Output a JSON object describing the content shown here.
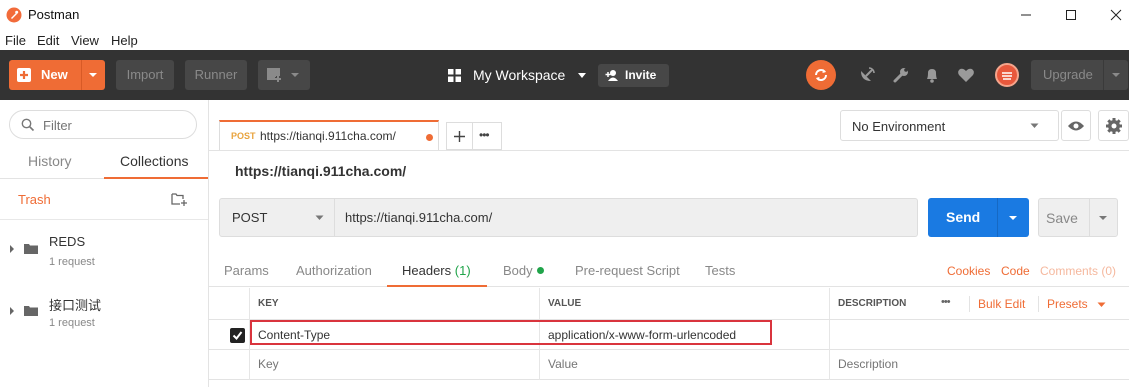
{
  "window": {
    "title": "Postman",
    "logo_color": "#f26b3a"
  },
  "menu": [
    "File",
    "Edit",
    "View",
    "Help"
  ],
  "toolbar": {
    "new_label": "New",
    "import_label": "Import",
    "runner_label": "Runner",
    "workspace_label": "My Workspace",
    "invite_label": "Invite",
    "upgrade_label": "Upgrade",
    "accent": "#ef6c35"
  },
  "sidebar": {
    "filter_placeholder": "Filter",
    "tabs": [
      "History",
      "Collections"
    ],
    "active_tab": "Collections",
    "trash_label": "Trash",
    "collections": [
      {
        "name": "REDS",
        "count": "1 request"
      },
      {
        "name": "接口测试",
        "count": "1 request"
      }
    ]
  },
  "request_tab": {
    "method": "POST",
    "url": "https://tianqi.911cha.com/"
  },
  "environment": {
    "selected": "No Environment"
  },
  "request": {
    "name": "https://tianqi.911cha.com/",
    "method": "POST",
    "url": "https://tianqi.911cha.com/",
    "send_label": "Send",
    "save_label": "Save",
    "send_color": "#1a7ae2"
  },
  "subtabs": {
    "params": "Params",
    "authorization": "Authorization",
    "headers": "Headers",
    "headers_count": "(1)",
    "body": "Body",
    "prerequest": "Pre-request Script",
    "tests": "Tests",
    "cookies": "Cookies",
    "code": "Code",
    "comments": "Comments (0)"
  },
  "headers_table": {
    "col_key": "KEY",
    "col_value": "VALUE",
    "col_description": "DESCRIPTION",
    "more": "•••",
    "bulk_edit": "Bulk Edit",
    "presets": "Presets",
    "rows": [
      {
        "checked": true,
        "key": "Content-Type",
        "value": "application/x-www-form-urlencoded",
        "description": ""
      }
    ],
    "placeholder_key": "Key",
    "placeholder_value": "Value",
    "placeholder_description": "Description"
  }
}
